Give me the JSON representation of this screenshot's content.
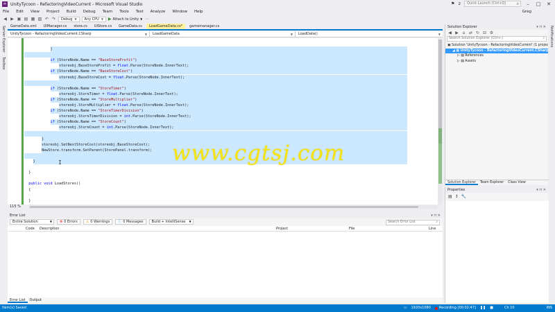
{
  "window": {
    "title": "UnityTycoon - RefactoringVideoCurrent - Microsoft Visual Studio",
    "notification_count": "2",
    "quick_launch_placeholder": "Quick Launch (Ctrl+Q)",
    "user": "Greg"
  },
  "menu": [
    "File",
    "Edit",
    "View",
    "Project",
    "Build",
    "Debug",
    "Team",
    "Tools",
    "Test",
    "Analyze",
    "Window",
    "Help"
  ],
  "toolbar": {
    "config": "Debug",
    "platform": "Any CPU",
    "attach": "Attach to Unity"
  },
  "side_tabs": [
    "Server Explorer",
    "Toolbox"
  ],
  "right_tabs": [
    "Notifications"
  ],
  "tabs": [
    "GameData.xml",
    "UIManager.cs",
    "store.cs",
    "UIStore.cs",
    "GameData.cs",
    "LoadGameData.cs*",
    "gamemanager.cs"
  ],
  "active_tab_index": 5,
  "nav": {
    "project": "UnityTycoon - RefactoringVideoCurrent.CSharp",
    "class": "LoadGameData",
    "member": "LoadData()"
  },
  "code_lines": [
    {
      "text": "            }",
      "sel": true
    },
    {
      "text": "",
      "sel": true
    },
    {
      "text": "            if (StoreNode.Name == \"BaseStoreProfit\")",
      "sel": true
    },
    {
      "text": "                storeobj.BaseStoreProfit = float.Parse(StoreNode.InnerText);",
      "sel": true
    },
    {
      "text": "            if (StoreNode.Name == \"BaseStoreCost\")",
      "sel": true
    },
    {
      "text": "                storeobj.BaseStoreCost = float.Parse(StoreNode.InnerText);",
      "sel": true
    },
    {
      "text": "",
      "sel": true
    },
    {
      "text": "            if (StoreNode.Name == \"StoreTimer\")",
      "sel": true
    },
    {
      "text": "                storeobj.StoreTimer = float.Parse(StoreNode.InnerText);",
      "sel": true
    },
    {
      "text": "            if (StoreNode.Name == \"StoreMultiplier\")",
      "sel": true
    },
    {
      "text": "                storeobj.StoreMultiplier = float.Parse(StoreNode.InnerText);",
      "sel": true
    },
    {
      "text": "            if (StoreNode.Name == \"StoreTimerDivision\")",
      "sel": true
    },
    {
      "text": "                storeobj.StoreTimerDivision = int.Parse(StoreNode.InnerText);",
      "sel": true
    },
    {
      "text": "            if (StoreNode.Name == \"StoreCount\")",
      "sel": true
    },
    {
      "text": "                storeobj.StoreCount = int.Parse(StoreNode.InnerText);",
      "sel": true
    },
    {
      "text": "",
      "sel": true
    },
    {
      "text": "        }",
      "sel": true
    },
    {
      "text": "        storeobj.SetNextStoreCost(storeobj.BaseStoreCost);",
      "sel": true
    },
    {
      "text": "        NewStore.transform.SetParent(StorePanel.transform);",
      "sel": true
    },
    {
      "text": "",
      "sel": true
    },
    {
      "text": "    }",
      "sel": true
    },
    {
      "text": "",
      "sel": false
    },
    {
      "text": "  }",
      "sel": false
    },
    {
      "text": "",
      "sel": false
    },
    {
      "text": "  public void LoadStores()",
      "sel": false
    },
    {
      "text": "  {",
      "sel": false
    },
    {
      "text": "",
      "sel": false
    },
    {
      "text": "  }",
      "sel": false
    }
  ],
  "zoom": "115 %",
  "watermark": "www.cgtsj.com",
  "solution_explorer": {
    "title": "Solution Explorer",
    "search_placeholder": "Search Solution Explorer (Ctrl+;)",
    "nodes": [
      {
        "label": "Solution 'UnityTycoon - RefactoringVideoCurrent' (1 project)",
        "indent": 0,
        "selected": false
      },
      {
        "label": "UnityTycoon - RefactoringVideoCurrent.CSharp",
        "indent": 1,
        "selected": true
      },
      {
        "label": "References",
        "indent": 2,
        "selected": false
      },
      {
        "label": "Assets",
        "indent": 2,
        "selected": false
      }
    ],
    "bottom_tabs": [
      "Solution Explorer",
      "Team Explorer",
      "Class View"
    ]
  },
  "properties": {
    "title": "Properties"
  },
  "error_list": {
    "title": "Error List",
    "scope": "Entire Solution",
    "errors": "0 Errors",
    "warnings": "0 Warnings",
    "messages": "0 Messages",
    "build": "Build + IntelliSense",
    "search_placeholder": "Search Error List",
    "columns": [
      "Code",
      "Description",
      "Project",
      "File",
      "Line"
    ],
    "bottom_tabs": [
      "Error List",
      "Output"
    ]
  },
  "status": {
    "text": "Item(s) Saved",
    "resolution": "1920x1080",
    "recording": "Recording [00:02:47]",
    "ch": "Ch 10",
    "ins": "INS"
  }
}
